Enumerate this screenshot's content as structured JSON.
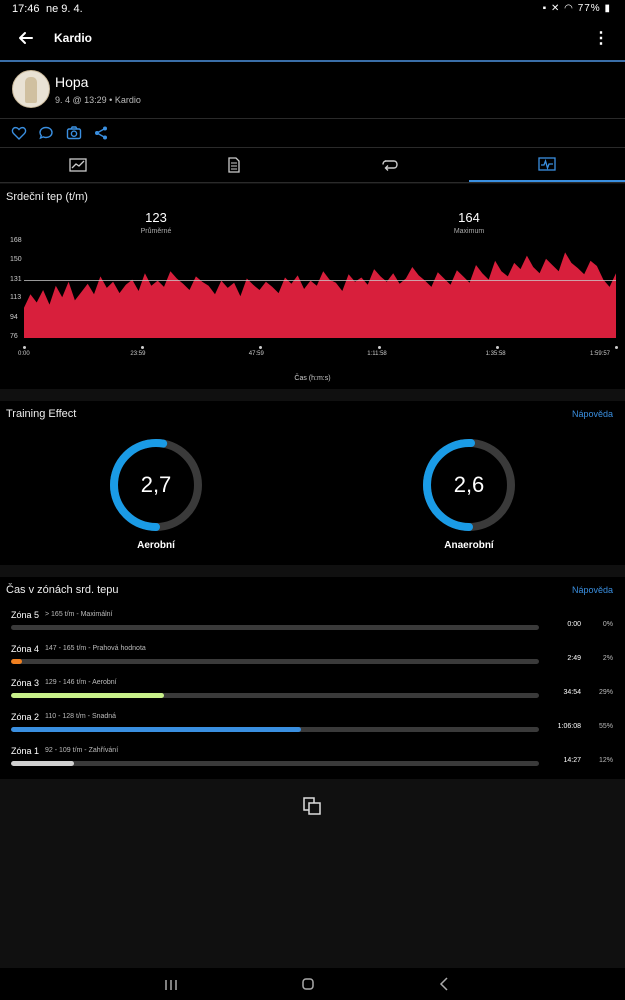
{
  "status": {
    "time": "17:46",
    "date": "ne 9. 4.",
    "battery": "77%"
  },
  "appbar": {
    "title": "Kardio"
  },
  "activity": {
    "name": "Hopa",
    "subtitle": "9. 4 @ 13:29 • Kardio"
  },
  "heart_rate": {
    "title": "Srdeční tep (t/m)",
    "avg_value": "123",
    "avg_label": "Průměrné",
    "max_value": "164",
    "max_label": "Maximum",
    "x_axis_label": "Čas (h:m:s)",
    "colors": {
      "fill": "#d81f3c",
      "average_line": "#cccccc"
    }
  },
  "chart_data": {
    "type": "area",
    "xlabel": "Čas (h:m:s)",
    "ylabel": "",
    "y_ticks": [
      "168",
      "150",
      "131",
      "113",
      "94",
      "76"
    ],
    "x_ticks": [
      "0:00",
      "23:59",
      "47:59",
      "1:11:58",
      "1:35:58",
      "1:59:57"
    ],
    "ylim": [
      76,
      168
    ],
    "average_line": 131,
    "series": [
      {
        "values": [
          105,
          118,
          110,
          122,
          108,
          126,
          115,
          130,
          112,
          120,
          128,
          118,
          135,
          124,
          130,
          119,
          127,
          132,
          121,
          138,
          126,
          131,
          125,
          140,
          133,
          128,
          122,
          135,
          130,
          126,
          118,
          131,
          124,
          129,
          116,
          133,
          127,
          122,
          130,
          125,
          119,
          134,
          128,
          136,
          123,
          131,
          126,
          140,
          132,
          129,
          121,
          137,
          130,
          134,
          127,
          142,
          135,
          130,
          138,
          128,
          133,
          144,
          136,
          131,
          125,
          139,
          133,
          127,
          141,
          135,
          129,
          146,
          138,
          132,
          150,
          140,
          135,
          148,
          142,
          155,
          144,
          138,
          152,
          146,
          140,
          158,
          148,
          143,
          137,
          150,
          145,
          132,
          125,
          138
        ]
      }
    ]
  },
  "training_effect": {
    "title": "Training Effect",
    "help": "Nápověda",
    "aerobic": {
      "value": "2,7",
      "label": "Aerobní",
      "level": 0.54
    },
    "anaerobic": {
      "value": "2,6",
      "label": "Anaerobní",
      "level": 0.52
    },
    "colors": {
      "arc": "#1a9be6",
      "track": "#3a3a3a"
    }
  },
  "zones": {
    "title": "Čas v zónách srd. tepu",
    "help": "Nápověda",
    "items": [
      {
        "name": "Zóna 5",
        "desc": "> 165 t/m - Maximální",
        "time": "0:00",
        "pct": "0%",
        "fraction": 0.0,
        "color": "#f08020"
      },
      {
        "name": "Zóna 4",
        "desc": "147 - 165 t/m - Prahová hodnota",
        "time": "2:49",
        "pct": "2%",
        "fraction": 0.02,
        "color": "#f08020"
      },
      {
        "name": "Zóna 3",
        "desc": "129 - 146 t/m - Aerobní",
        "time": "34:54",
        "pct": "29%",
        "fraction": 0.29,
        "color": "#c8f08a"
      },
      {
        "name": "Zóna 2",
        "desc": "110 - 128 t/m - Snadná",
        "time": "1:06:08",
        "pct": "55%",
        "fraction": 0.55,
        "color": "#3a8fe0"
      },
      {
        "name": "Zóna 1",
        "desc": "92 - 109 t/m - Zahřívání",
        "time": "14:27",
        "pct": "12%",
        "fraction": 0.12,
        "color": "#d0d0d0"
      }
    ]
  }
}
